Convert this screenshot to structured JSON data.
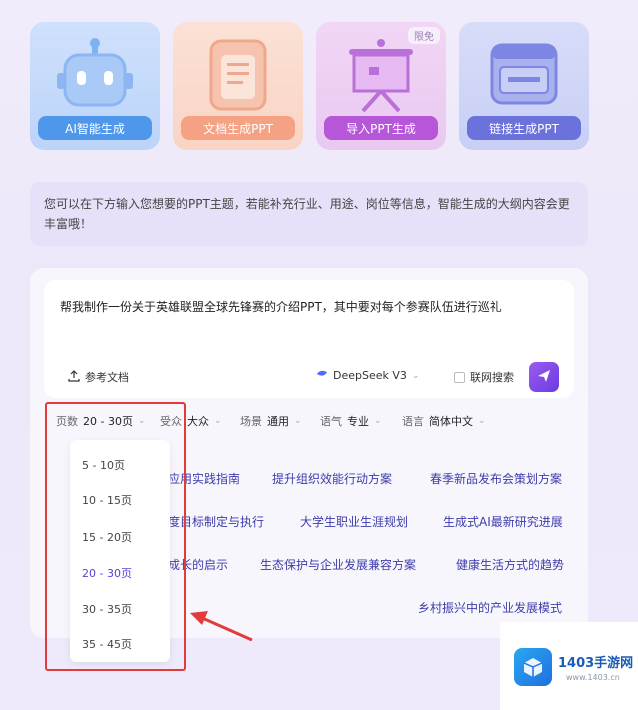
{
  "mode_cards": [
    {
      "label": "AI智能生成",
      "color": "#4f97ea"
    },
    {
      "label": "文档生成PPT",
      "color": "#f5a184"
    },
    {
      "label": "导入PPT生成",
      "color": "#b656d9",
      "badge": "限免"
    },
    {
      "label": "链接生成PPT",
      "color": "#6c72db"
    }
  ],
  "hint": "您可以在下方输入您想要的PPT主题，若能补充行业、用途、岗位等信息，智能生成的大纲内容会更丰富哦！",
  "prompt": "帮我制作一份关于英雄联盟全球先锋赛的介绍PPT，其中要对每个参赛队伍进行巡礼",
  "toolbar": {
    "reference_doc": "参考文档",
    "model": "DeepSeek V3",
    "web_search": "联网搜索"
  },
  "options": {
    "pages_label": "页数",
    "pages_value": "20 - 30页",
    "audience_label": "受众",
    "audience_value": "大众",
    "scene_label": "场景",
    "scene_value": "通用",
    "tone_label": "语气",
    "tone_value": "专业",
    "lang_label": "语言",
    "lang_value": "简体中文"
  },
  "page_dropdown": [
    "5 - 10页",
    "10 - 15页",
    "15 - 20页",
    "20 - 30页",
    "30 - 35页",
    "35 - 45页"
  ],
  "page_dropdown_selected": "20 - 30页",
  "suggestions": {
    "row1": [
      "应用实践指南",
      "提升组织效能行动方案",
      "春季新品发布会策划方案"
    ],
    "row2": [
      "度目标制定与执行",
      "大学生职业生涯规划",
      "生成式AI最新研究进展"
    ],
    "row3": [
      "成长的启示",
      "生态保护与企业发展兼容方案",
      "健康生活方式的趋势"
    ],
    "row4": [
      "乡村振兴中的产业发展模式"
    ]
  },
  "watermark": {
    "title": "1403手游网",
    "url": "www.1403.cn"
  },
  "colors": {
    "accent": "#6b3be0",
    "highlight": "#e23b3b"
  }
}
